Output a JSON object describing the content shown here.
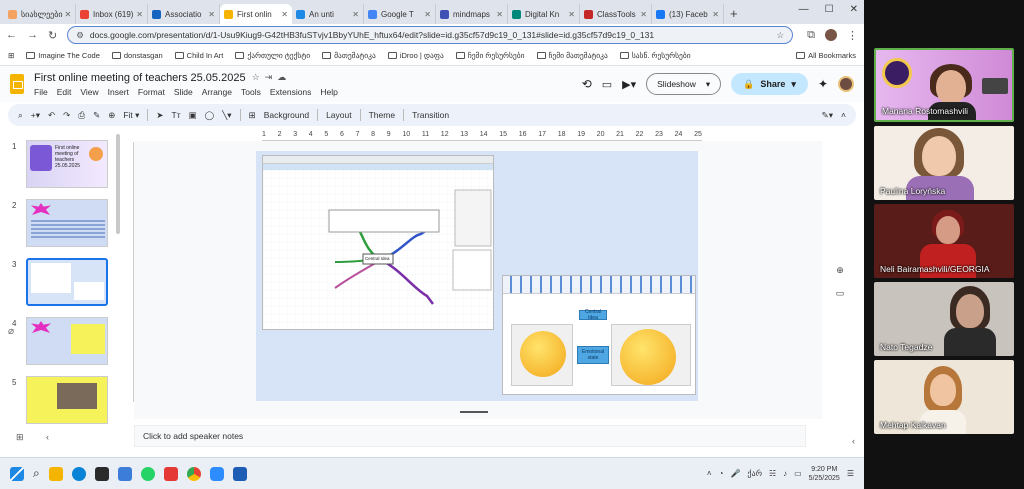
{
  "browser": {
    "tabs": [
      {
        "label": "სიახლეები",
        "color": "#f4a261"
      },
      {
        "label": "Inbox (619)",
        "color": "#ea4335"
      },
      {
        "label": "Associatio",
        "color": "#1565c0"
      },
      {
        "label": "First onlin",
        "color": "#f4b400"
      },
      {
        "label": "An unti",
        "color": "#1e88e5"
      },
      {
        "label": "Google T",
        "color": "#4285f4"
      },
      {
        "label": "mindmaps",
        "color": "#3f51b5"
      },
      {
        "label": "Digital Kn",
        "color": "#00897b"
      },
      {
        "label": "ClassTools",
        "color": "#c62828"
      },
      {
        "label": "(13) Faceb",
        "color": "#1877f2"
      }
    ],
    "new_tab": "+",
    "url": "docs.google.com/presentation/d/1-Usu9Kiug9-G42tHB3fuSTvjv1BbyYUhE_hftux64/edit?slide=id.g35cf57d9c19_0_131#slide=id.g35cf57d9c19_0_131",
    "bookmarks": [
      "Imagine The Code",
      "donstasgan",
      "Child In Art",
      "ქართული ტექსტი",
      "მათემატიკა",
      "iDroo | დაფა",
      "ჩემი რესურსები",
      "ჩემი მათემატიკა",
      "სასწ. რესურსები"
    ],
    "all_bookmarks": "All Bookmarks"
  },
  "doc": {
    "title": "First online meeting of teachers 25.05.2025",
    "menus": [
      "File",
      "Edit",
      "View",
      "Insert",
      "Format",
      "Slide",
      "Arrange",
      "Tools",
      "Extensions",
      "Help"
    ],
    "slideshow": "Slideshow",
    "share": "Share"
  },
  "toolbar": {
    "zoom": "Fit",
    "background": "Background",
    "layout": "Layout",
    "theme": "Theme",
    "transition": "Transition"
  },
  "ruler": [
    "1",
    "2",
    "3",
    "4",
    "5",
    "6",
    "7",
    "8",
    "9",
    "10",
    "11",
    "12",
    "13",
    "14",
    "15",
    "16",
    "17",
    "18",
    "19",
    "20",
    "21",
    "22",
    "23",
    "24",
    "25"
  ],
  "filmstrip": [
    {
      "num": "1",
      "text": "First online meeting of teachers 25.05.2025"
    },
    {
      "num": "2",
      "text": ""
    },
    {
      "num": "3",
      "text": ""
    },
    {
      "num": "4",
      "text": ""
    },
    {
      "num": "5",
      "text": ""
    }
  ],
  "slide": {
    "mindmap_center": "Central Idea",
    "editor_nodes": [
      "Central Idea",
      "Emotional state"
    ]
  },
  "notes_placeholder": "Click to add speaker notes",
  "taskbar": {
    "lang": "ქარ",
    "time": "9:20 PM",
    "date": "5/25/2025"
  },
  "participants": [
    {
      "name": "Manana Rostomashvili",
      "active": true
    },
    {
      "name": "Paulina Loryńska",
      "active": false
    },
    {
      "name": "Neli Bairamashvili/GEORGIA",
      "active": false
    },
    {
      "name": "Nato Tegadze",
      "active": false
    },
    {
      "name": "Mehtap Kalkavan",
      "active": false
    }
  ]
}
